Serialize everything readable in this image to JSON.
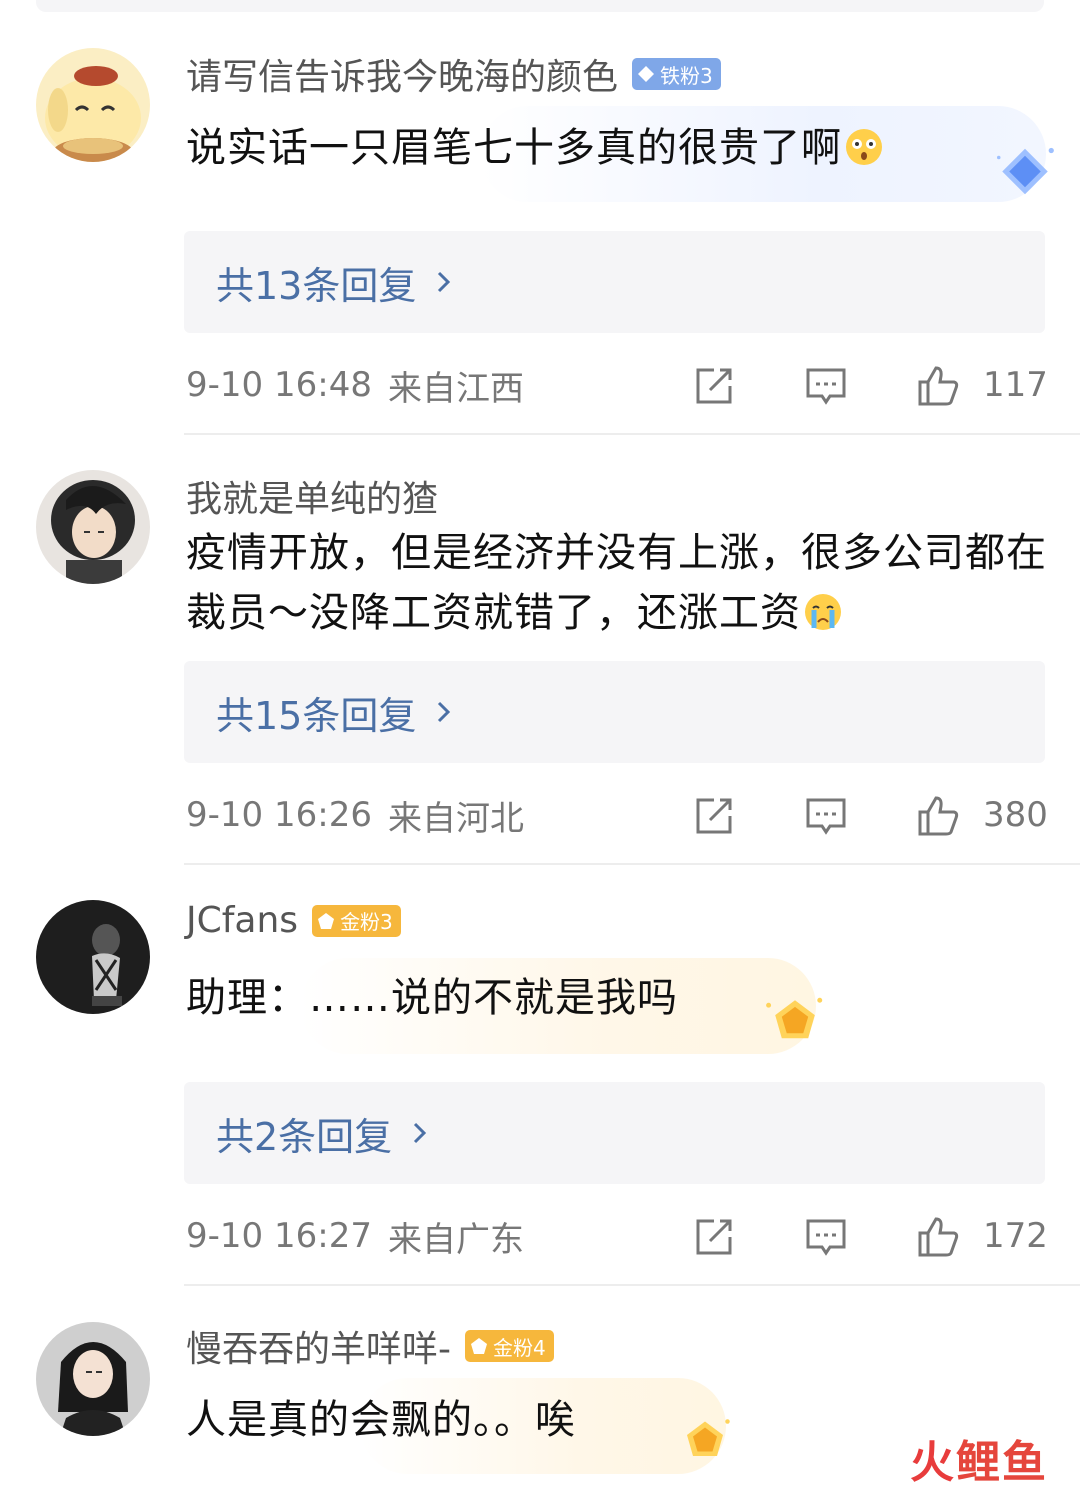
{
  "comments": [
    {
      "username": "请写信告诉我今晚海的颜色",
      "badge": "铁粉3",
      "text": "说实话一只眉笔七十多真的很贵了啊",
      "emoji": "flushed-face",
      "replies": "共13条回复",
      "time": "9-10 16:48",
      "location": "来自江西",
      "likes": "117"
    },
    {
      "username": "我就是单纯的猹",
      "badge": "",
      "text": "疫情开放，但是经济并没有上涨，很多公司都在裁员～没降工资就错了，还涨工资",
      "emoji": "crying-face",
      "replies": "共15条回复",
      "time": "9-10 16:26",
      "location": "来自河北",
      "likes": "380"
    },
    {
      "username": "JCfans",
      "badge": "金粉3",
      "text": "助理：……说的不就是我吗",
      "emoji": "",
      "replies": "共2条回复",
      "time": "9-10 16:27",
      "location": "来自广东",
      "likes": "172"
    },
    {
      "username": "慢吞吞的羊咩咩-",
      "badge": "金粉4",
      "text": "人是真的会飘的。。唉",
      "emoji": ""
    }
  ],
  "watermark": {
    "part1": "火",
    "part2": "鲤鱼"
  },
  "colors": {
    "link": "#4a6fa5",
    "iron_badge": "#7fa7e8",
    "gold_badge": "#f6b73c",
    "meta": "#777777"
  }
}
